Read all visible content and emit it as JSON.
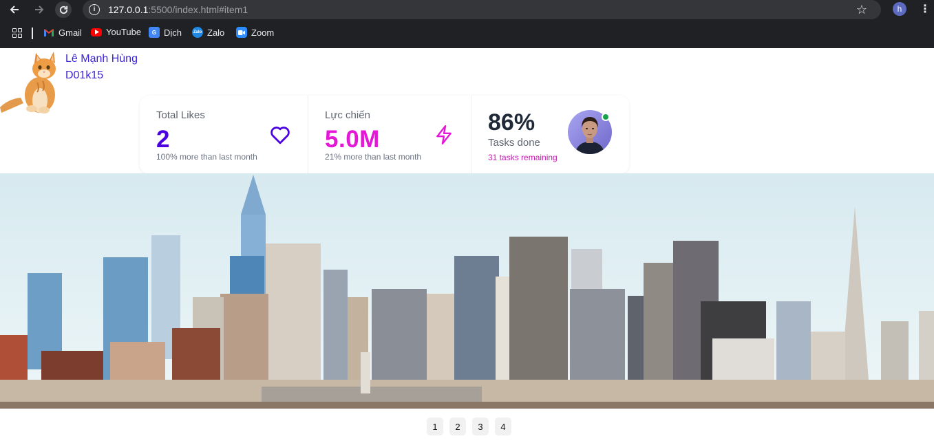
{
  "browser": {
    "url_host": "127.0.0.1",
    "url_rest": ":5500/index.html#item1",
    "profile_initial": "h",
    "bookmarks": [
      {
        "label": "Gmail",
        "icon": "gmail-icon",
        "color": "#ea4335"
      },
      {
        "label": "YouTube",
        "icon": "youtube-icon",
        "color": "#ff0000"
      },
      {
        "label": "Dịch",
        "icon": "translate-icon",
        "color": "#4285f4"
      },
      {
        "label": "Zalo",
        "icon": "zalo-icon",
        "color": "#1e88e5"
      },
      {
        "label": "Zoom",
        "icon": "zoom-icon",
        "color": "#2d8cff"
      }
    ]
  },
  "profile": {
    "name": "Lê Mạnh Hùng",
    "class": "D01k15"
  },
  "stats": {
    "likes": {
      "title": "Total Likes",
      "value": "2",
      "desc": "100% more than last month",
      "color": "#4a00e0",
      "icon": "heart-icon"
    },
    "power": {
      "title": "Lực chiến",
      "value": "5.0M",
      "desc": "21% more than last month",
      "color": "#e417d6",
      "icon": "lightning-icon"
    },
    "tasks": {
      "value": "86%",
      "title": "Tasks done",
      "desc": "31 tasks remaining",
      "status_color": "#16a34a"
    }
  },
  "pagination": [
    "1",
    "2",
    "3",
    "4"
  ]
}
